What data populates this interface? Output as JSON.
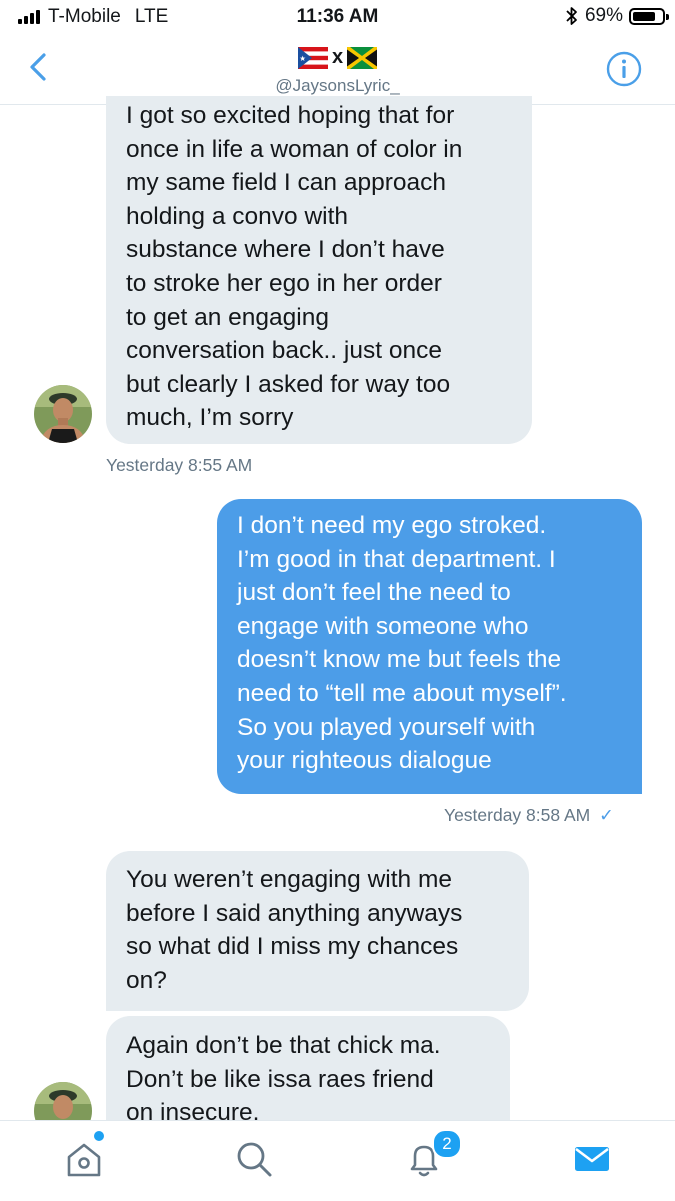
{
  "status_bar": {
    "carrier": "T-Mobile",
    "network": "LTE",
    "time": "11:36 AM",
    "battery": "69%",
    "battery_level": 0.69
  },
  "header": {
    "handle": "@JaysonsLyric_",
    "flags_separator": "x",
    "flags": [
      "puerto-rico-flag",
      "jamaica-flag"
    ]
  },
  "messages": [
    {
      "direction": "received",
      "lines": [
        "I got so excited hoping that for",
        "once in life a woman of color in",
        "my same field I can approach",
        "holding a convo with",
        "substance where I don’t have",
        "to stroke her ego in her order",
        "to get an engaging",
        "conversation back.. just once",
        "but clearly I asked for way too",
        "much, I’m sorry"
      ],
      "timestamp": "Yesterday 8:55 AM"
    },
    {
      "direction": "sent",
      "lines": [
        "I don’t need my ego stroked.",
        "I’m good in that department. I",
        "just don’t feel the need to",
        "engage with someone who",
        "doesn’t know me but feels the",
        "need to “tell me about myself”.",
        "So you played yourself with",
        "your righteous dialogue"
      ],
      "timestamp": "Yesterday 8:58 AM",
      "read_mark": "✓"
    },
    {
      "direction": "received",
      "lines": [
        "You weren’t engaging with me",
        "before I said anything anyways",
        "so what did I miss my chances",
        "on?"
      ]
    },
    {
      "direction": "received",
      "lines": [
        "Again don’t be that chick ma.",
        "Don’t be like issa raes friend",
        "on insecure."
      ]
    }
  ],
  "tabbar": {
    "notifications_badge": "2",
    "active_tab": "messages",
    "colors": {
      "accent": "#1da1f2",
      "icon": "#657786"
    }
  },
  "colors": {
    "sent_bubble": "#4c9de8",
    "received_bubble": "#e6ecf0",
    "header_icons": "#4a9fe8"
  }
}
